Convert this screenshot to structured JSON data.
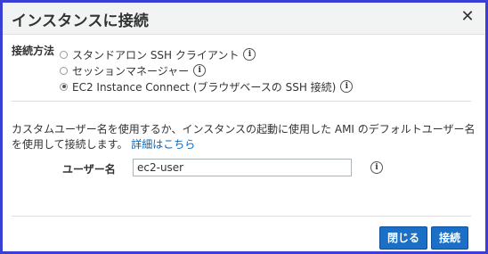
{
  "dialog": {
    "title": "インスタンスに接続",
    "close_glyph": "✕"
  },
  "connection": {
    "label": "接続方法",
    "options": [
      {
        "label": "スタンドアロン SSH クライアント",
        "selected": false
      },
      {
        "label": "セッションマネージャー",
        "selected": false
      },
      {
        "label": "EC2 Instance Connect (ブラウザベースの SSH 接続)",
        "selected": true
      }
    ],
    "info_glyph": "i"
  },
  "description": {
    "text": "カスタムユーザー名を使用するか、インスタンスの起動に使用した AMI のデフォルトユーザー名を使用して接続します。",
    "link": "詳細はこちら"
  },
  "username": {
    "label": "ユーザー名",
    "value": "ec2-user"
  },
  "buttons": {
    "close": "閉じる",
    "connect": "接続"
  },
  "colors": {
    "background": "#3a3fd6",
    "primary_button": "#1b6fc6",
    "link": "#0066c0"
  }
}
